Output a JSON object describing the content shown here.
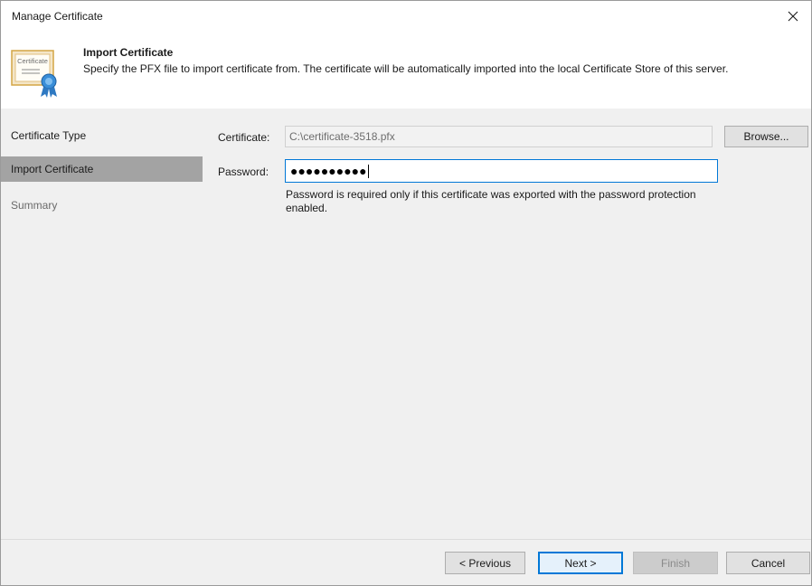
{
  "window": {
    "title": "Manage Certificate"
  },
  "header": {
    "title": "Import Certificate",
    "description": "Specify the PFX file to import certificate from. The certificate will be automatically imported into the local Certificate Store of this server.",
    "icon_text": "Certificate"
  },
  "sidebar": {
    "items": [
      {
        "label": "Certificate Type",
        "state": "done"
      },
      {
        "label": "Import Certificate",
        "state": "active"
      },
      {
        "label": "Summary",
        "state": "pending"
      }
    ]
  },
  "form": {
    "certificate_label": "Certificate:",
    "certificate_value": "C:\\certificate-3518.pfx",
    "browse_label": "Browse...",
    "password_label": "Password:",
    "password_masked": "●●●●●●●●●●",
    "hint": "Password is required only if this certificate was exported with the password protection enabled."
  },
  "footer": {
    "previous_label": "< Previous",
    "next_label": "Next >",
    "finish_label": "Finish",
    "cancel_label": "Cancel"
  },
  "colors": {
    "accent": "#0078d7",
    "active_nav": "#a3a3a3",
    "panel_bg": "#f0f0f0"
  }
}
